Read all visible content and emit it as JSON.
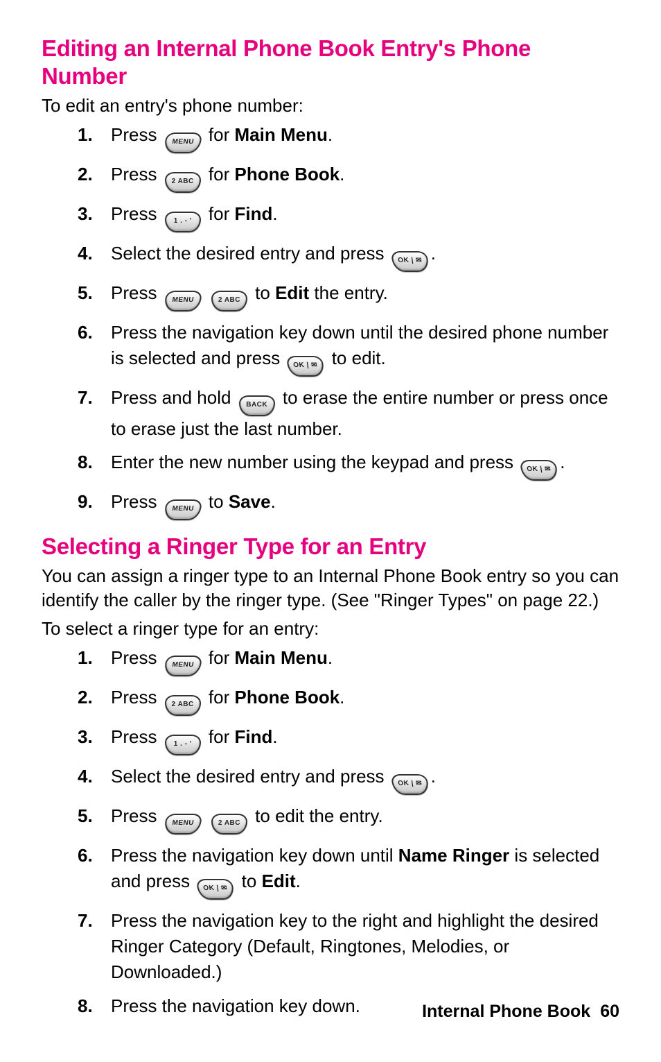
{
  "section1": {
    "heading": "Editing an Internal Phone Book Entry's Phone Number",
    "intro": "To edit an entry's phone number:",
    "steps": [
      {
        "pre": "Press ",
        "keys": [
          "MENU"
        ],
        "post_a": " for ",
        "bold": "Main Menu",
        "post_b": "."
      },
      {
        "pre": "Press ",
        "keys": [
          "2 ABC"
        ],
        "post_a": " for ",
        "bold": "Phone Book",
        "post_b": "."
      },
      {
        "pre": "Press ",
        "keys": [
          "1 . - '"
        ],
        "post_a": " for ",
        "bold": "Find",
        "post_b": "."
      },
      {
        "pre": "Select the desired entry and press ",
        "keys": [
          "OK | ✉"
        ],
        "post_a": "",
        "bold": "",
        "post_b": "."
      },
      {
        "pre": "Press ",
        "keys": [
          "MENU",
          "2 ABC"
        ],
        "post_a": " to ",
        "bold": "Edit",
        "post_b": " the entry."
      },
      {
        "pre": "Press the navigation key down until the desired phone number is selected and press ",
        "keys": [
          "OK | ✉"
        ],
        "post_a": " to edit.",
        "bold": "",
        "post_b": ""
      },
      {
        "pre": "Press and hold ",
        "keys": [
          "BACK"
        ],
        "post_a": " to erase the entire number or press once to erase just the last number.",
        "bold": "",
        "post_b": ""
      },
      {
        "pre": "Enter the new number using the keypad and press ",
        "keys": [
          "OK | ✉"
        ],
        "post_a": "",
        "bold": "",
        "post_b": "."
      },
      {
        "pre": "Press ",
        "keys": [
          "MENU"
        ],
        "post_a": " to ",
        "bold": "Save",
        "post_b": "."
      }
    ]
  },
  "section2": {
    "heading": "Selecting a Ringer Type for an Entry",
    "intro1": "You can assign a ringer type to an Internal Phone Book entry so you can identify the caller by the ringer type. (See \"Ringer Types\" on page 22.)",
    "intro2": "To select a ringer type for an entry:",
    "steps": [
      {
        "pre": "Press ",
        "keys": [
          "MENU"
        ],
        "post_a": " for ",
        "bold": "Main Menu",
        "post_b": "."
      },
      {
        "pre": "Press ",
        "keys": [
          "2 ABC"
        ],
        "post_a": " for ",
        "bold": "Phone Book",
        "post_b": "."
      },
      {
        "pre": "Press ",
        "keys": [
          "1 . - '"
        ],
        "post_a": " for ",
        "bold": "Find",
        "post_b": "."
      },
      {
        "pre": "Select the desired entry and press ",
        "keys": [
          "OK | ✉"
        ],
        "post_a": "",
        "bold": "",
        "post_b": "."
      },
      {
        "pre": "Press ",
        "keys": [
          "MENU",
          "2 ABC"
        ],
        "post_a": " to edit the entry.",
        "bold": "",
        "post_b": ""
      },
      {
        "pre": "Press the navigation key down until ",
        "keys": [],
        "post_a": "",
        "bold": "Name Ringer",
        "post_b": " is selected and press ",
        "keys2": [
          "OK | ✉"
        ],
        "post_c": " to ",
        "bold2": "Edit",
        "post_d": "."
      },
      {
        "pre": "Press the navigation key to the right and highlight the desired Ringer Category (Default, Ringtones, Melodies, or Downloaded.)",
        "keys": [],
        "post_a": "",
        "bold": "",
        "post_b": ""
      },
      {
        "pre": "Press the navigation key down.",
        "keys": [],
        "post_a": "",
        "bold": "",
        "post_b": ""
      }
    ]
  },
  "footer": {
    "label": "Internal Phone Book",
    "page": "60"
  }
}
